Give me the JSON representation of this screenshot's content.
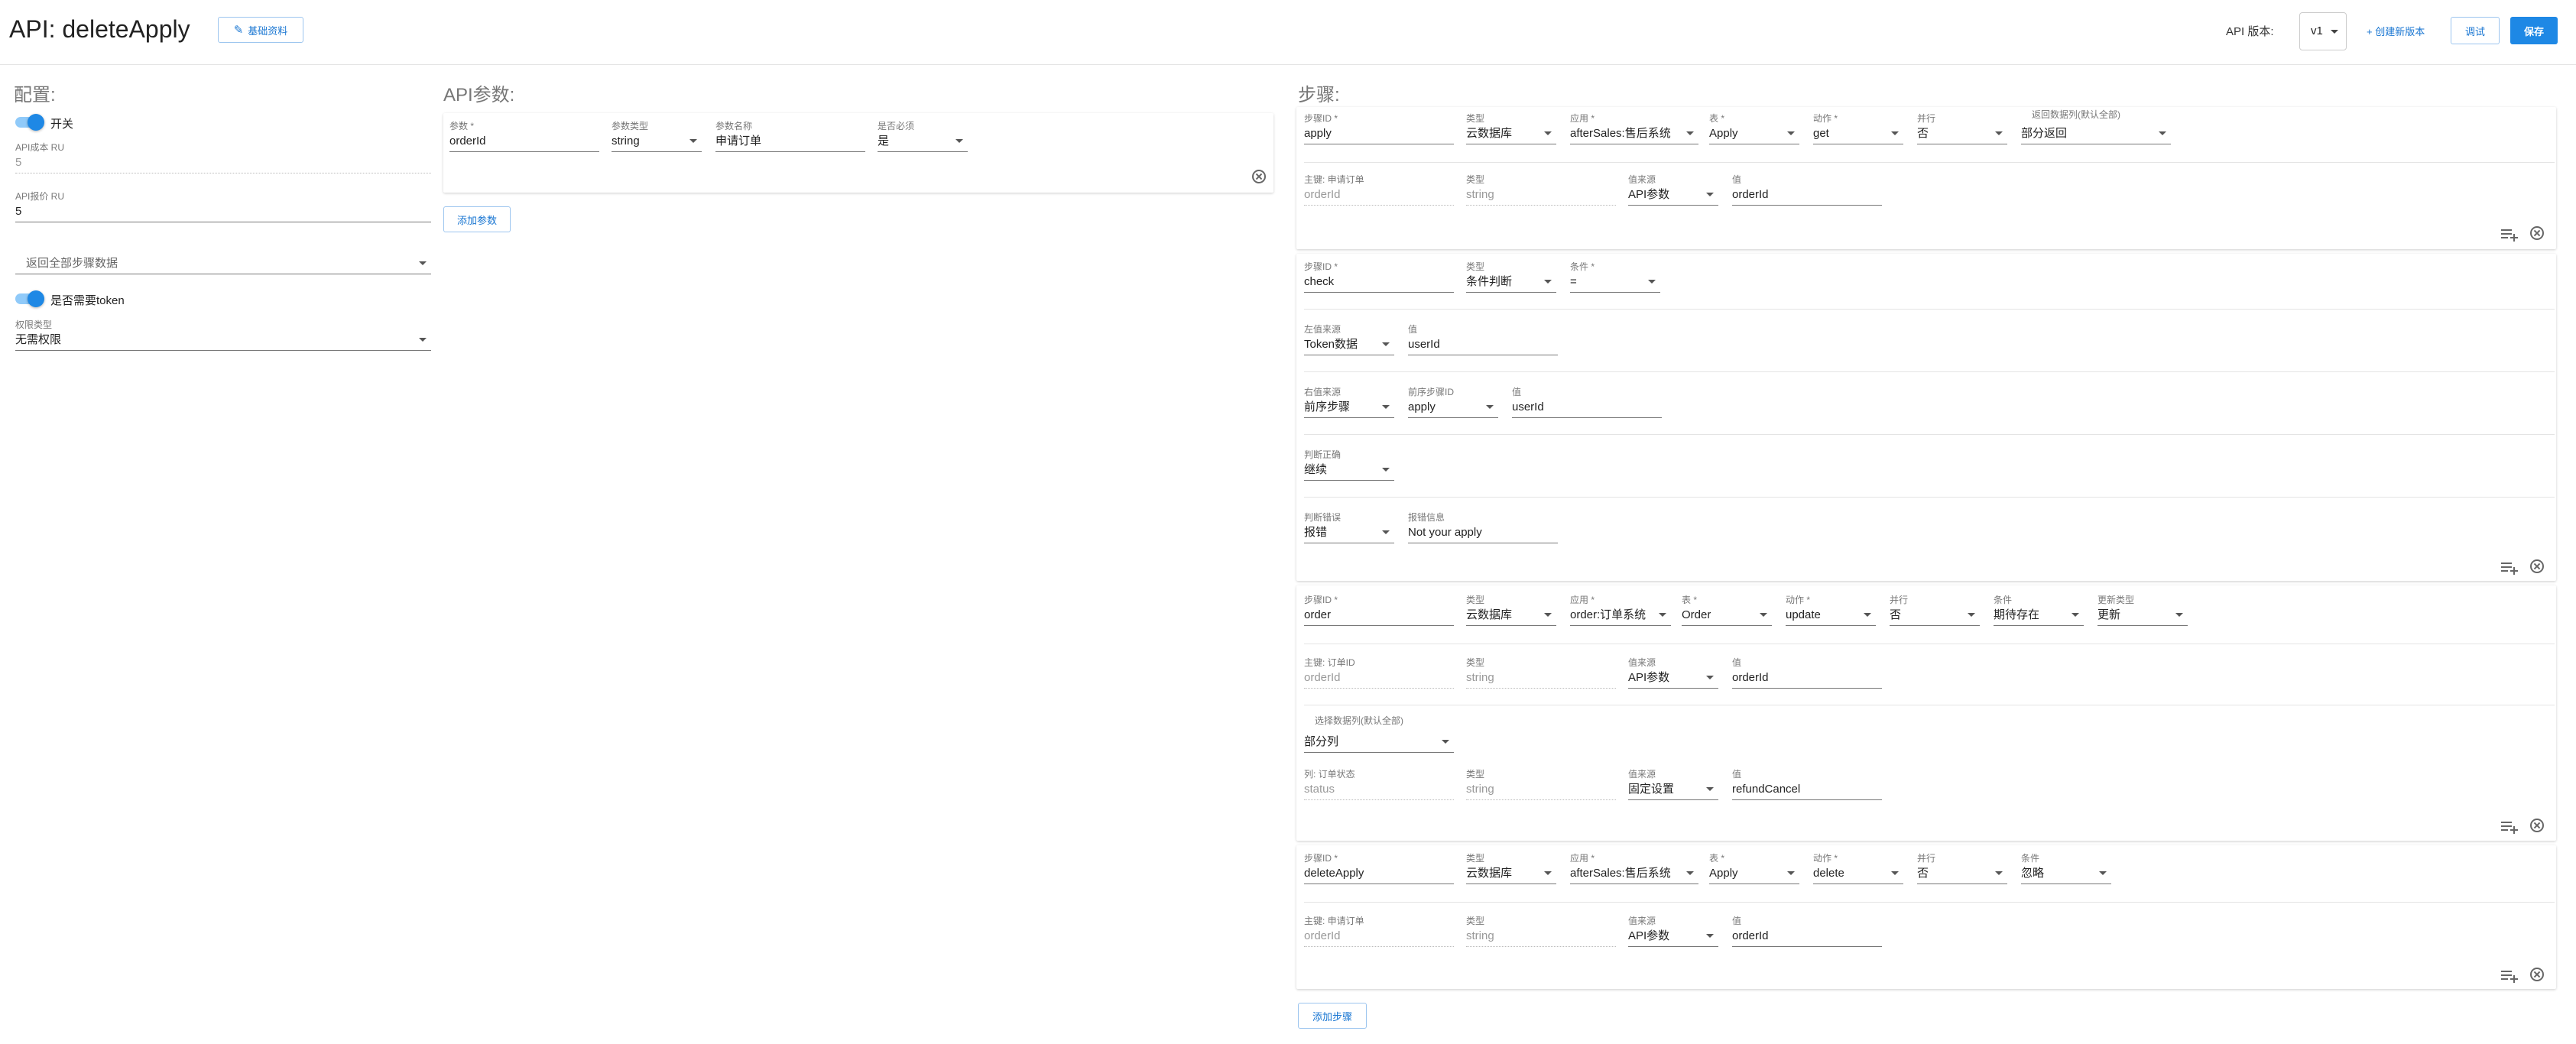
{
  "header": {
    "title": "API: deleteApply",
    "basic_info_btn": "基础资料",
    "version_label": "API 版本:",
    "version_value": "v1",
    "create_version": "+ 创建新版本",
    "debug_btn": "调试",
    "save_btn": "保存"
  },
  "colors": {
    "primary": "#1e88e5",
    "toggle_track": "#90caf9"
  },
  "config": {
    "heading": "配置:",
    "switch_label": "开关",
    "ru_cost_label": "API成本 RU",
    "ru_cost_value": "5",
    "ru_price_label": "API报价 RU",
    "ru_price_value": "5",
    "return_all_placeholder": "返回全部步骤数据",
    "need_token_label": "是否需要token",
    "permission_label": "权限类型",
    "permission_value": "无需权限"
  },
  "params": {
    "heading": "API参数:",
    "row": {
      "param_label": "参数 *",
      "param_value": "orderId",
      "type_label": "参数类型",
      "type_value": "string",
      "name_label": "参数名称",
      "name_value": "申请订单",
      "required_label": "是否必须",
      "required_value": "是"
    },
    "add_btn": "添加参数"
  },
  "steps": {
    "heading": "步骤:",
    "add_btn": "添加步骤",
    "s1": {
      "id_label": "步骤ID *",
      "id": "apply",
      "type_label": "类型",
      "type": "云数据库",
      "app_label": "应用 *",
      "app": "afterSales:售后系统",
      "table_label": "表 *",
      "table": "Apply",
      "action_label": "动作 *",
      "action": "get",
      "parallel_label": "并行",
      "parallel": "否",
      "ret_label": "返回数据列(默认全部)",
      "ret": "部分返回",
      "key_label": "主键: 申请订单",
      "key": "orderId",
      "ktype_label": "类型",
      "ktype": "string",
      "src_label": "值来源",
      "src": "API参数",
      "val_label": "值",
      "val": "orderId"
    },
    "s2": {
      "id_label": "步骤ID *",
      "id": "check",
      "type_label": "类型",
      "type": "条件判断",
      "cond_label": "条件 *",
      "cond": "=",
      "l_src_label": "左值来源",
      "l_src": "Token数据",
      "l_val_label": "值",
      "l_val": "userId",
      "r_src_label": "右值来源",
      "r_src": "前序步骤",
      "r_step_label": "前序步骤ID",
      "r_step": "apply",
      "r_val_label": "值",
      "r_val": "userId",
      "ok_label": "判断正确",
      "ok": "继续",
      "err_label": "判断错误",
      "err": "报错",
      "msg_label": "报错信息",
      "msg": "Not your apply"
    },
    "s3": {
      "id_label": "步骤ID *",
      "id": "order",
      "type_label": "类型",
      "type": "云数据库",
      "app_label": "应用 *",
      "app": "order:订单系统",
      "table_label": "表 *",
      "table": "Order",
      "action_label": "动作 *",
      "action": "update",
      "parallel_label": "并行",
      "parallel": "否",
      "cond_label": "条件",
      "cond": "期待存在",
      "utype_label": "更新类型",
      "utype": "更新",
      "key_label": "主键: 订单ID",
      "key": "orderId",
      "ktype_label": "类型",
      "ktype": "string",
      "src_label": "值来源",
      "src": "API参数",
      "val_label": "值",
      "val": "orderId",
      "sel_label": "选择数据列(默认全部)",
      "sel": "部分列",
      "col_label": "列: 订单状态",
      "col": "status",
      "ctype_label": "类型",
      "ctype": "string",
      "csrc_label": "值来源",
      "csrc": "固定设置",
      "cval_label": "值",
      "cval": "refundCancel"
    },
    "s4": {
      "id_label": "步骤ID *",
      "id": "deleteApply",
      "type_label": "类型",
      "type": "云数据库",
      "app_label": "应用 *",
      "app": "afterSales:售后系统",
      "table_label": "表 *",
      "table": "Apply",
      "action_label": "动作 *",
      "action": "delete",
      "parallel_label": "并行",
      "parallel": "否",
      "cond_label": "条件",
      "cond": "忽略",
      "key_label": "主键: 申请订单",
      "key": "orderId",
      "ktype_label": "类型",
      "ktype": "string",
      "src_label": "值来源",
      "src": "API参数",
      "val_label": "值",
      "val": "orderId"
    }
  }
}
